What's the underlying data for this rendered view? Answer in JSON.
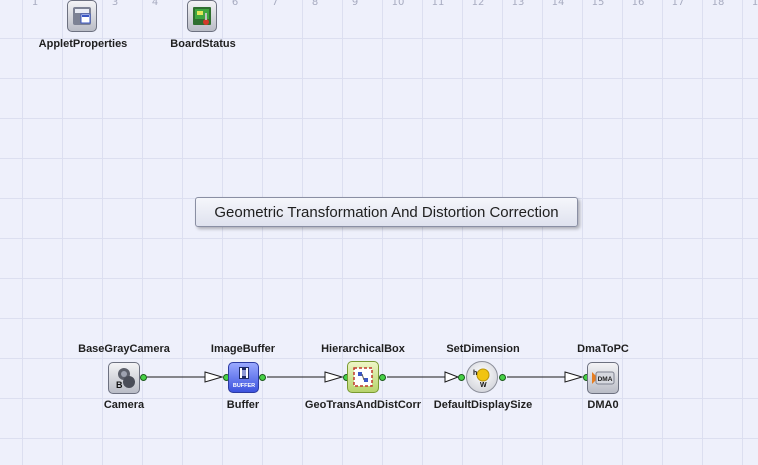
{
  "ruler": [
    "1",
    "2",
    "3",
    "4",
    "5",
    "6",
    "7",
    "8",
    "9",
    "10",
    "11",
    "12",
    "13",
    "14",
    "15",
    "16",
    "17",
    "18",
    "1"
  ],
  "top_nodes": {
    "applet_properties": {
      "label": "AppletProperties",
      "icon": "applet-properties-icon"
    },
    "board_status": {
      "label": "BoardStatus",
      "icon": "board-status-icon"
    }
  },
  "panel_title": "Geometric Transformation And Distortion Correction",
  "pipeline": [
    {
      "type": "BaseGrayCamera",
      "name": "Camera",
      "icon": "camera-icon",
      "icon_text": "B"
    },
    {
      "type": "ImageBuffer",
      "name": "Buffer",
      "icon": "buffer-icon",
      "icon_text": "BUFFER"
    },
    {
      "type": "HierarchicalBox",
      "name": "GeoTransAndDistCorr",
      "icon": "hierarchical-box-icon",
      "icon_text": ""
    },
    {
      "type": "SetDimension",
      "name": "DefaultDisplaySize",
      "icon": "set-dimension-icon",
      "icon_text": "W"
    },
    {
      "type": "DmaToPC",
      "name": "DMA0",
      "icon": "dma-icon",
      "icon_text": "DMA"
    }
  ],
  "colors": {
    "canvas": "#eef0fb",
    "grid": "#dcdff0",
    "port": "#46d146",
    "link": "#1a1a1a"
  }
}
